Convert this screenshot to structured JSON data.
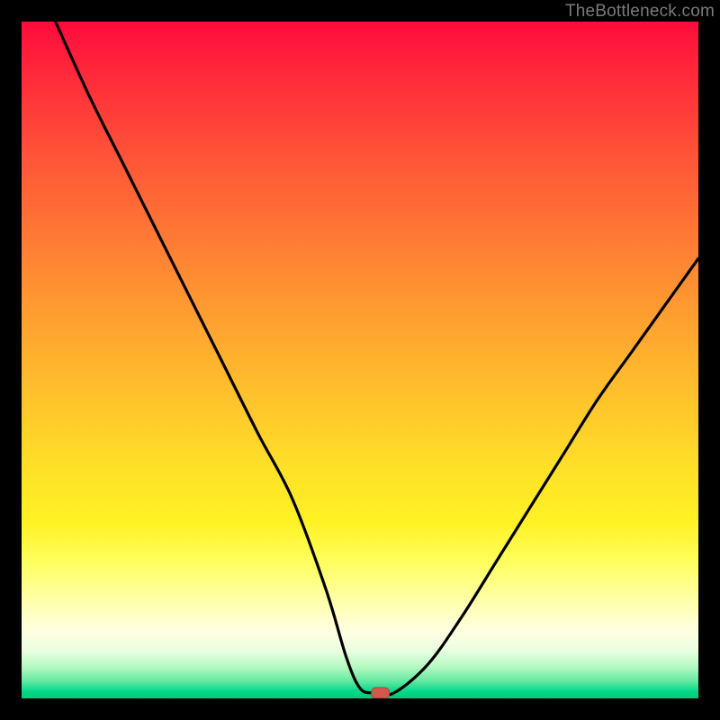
{
  "watermark": "TheBottleneck.com",
  "chart_data": {
    "type": "line",
    "title": "",
    "xlabel": "",
    "ylabel": "",
    "xlim": [
      0,
      100
    ],
    "ylim": [
      0,
      100
    ],
    "series": [
      {
        "name": "bottleneck-curve",
        "x": [
          5,
          10,
          15,
          20,
          25,
          30,
          35,
          40,
          45,
          48,
          50,
          52,
          55,
          60,
          65,
          70,
          75,
          80,
          85,
          90,
          95,
          100
        ],
        "values": [
          100,
          89,
          79,
          69,
          59,
          49,
          39,
          29.5,
          16,
          6,
          1.5,
          0.8,
          0.8,
          5,
          12,
          20,
          28,
          36,
          44,
          51,
          58,
          65
        ]
      }
    ],
    "marker": {
      "x": 53,
      "y": 0.8,
      "shape": "rounded-rect",
      "color": "#d4574e"
    },
    "background_gradient": {
      "stops": [
        {
          "pos": 0.0,
          "color": "#ff0b3c"
        },
        {
          "pos": 0.5,
          "color": "#ffb22e"
        },
        {
          "pos": 0.8,
          "color": "#ffff60"
        },
        {
          "pos": 1.0,
          "color": "#00c878"
        }
      ]
    }
  }
}
